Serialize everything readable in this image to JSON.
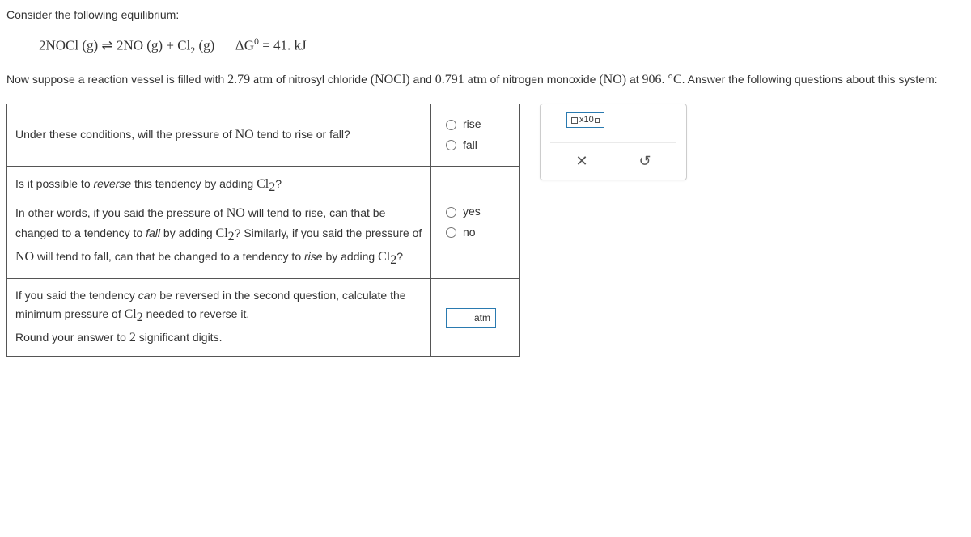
{
  "intro": "Consider the following equilibrium:",
  "equation": {
    "lhs": "2NOCl (g)",
    "arrow": "⇌",
    "rhs1": "2NO (g)",
    "plus": "+",
    "rhs2_cl": "Cl",
    "rhs2_sub": "2",
    "rhs2_state": " (g)",
    "dg_label": "ΔG",
    "dg_sup": "0",
    "dg_eq": " = 41. kJ"
  },
  "paragraph": {
    "p1a": "Now suppose a reaction vessel is filled with ",
    "p1_v1": "2.79 atm",
    "p1b": " of nitrosyl chloride ",
    "p1_f1": "(NOCl)",
    "p1c": " and ",
    "p1_v2": "0.791 atm",
    "p1d": " of nitrogen monoxide ",
    "p1_f2": "(NO)",
    "p1e": " at ",
    "p1_v3": "906. °C",
    "p1f": ". Answer the following questions about this system:"
  },
  "q1": {
    "a": "Under these conditions, will the pressure of ",
    "no": "NO",
    "b": " tend to rise or fall?",
    "opt_rise": "rise",
    "opt_fall": "fall"
  },
  "q2": {
    "l1a": "Is it possible to ",
    "l1_rev": "reverse",
    "l1b": " this tendency by adding ",
    "cl2_cl": "Cl",
    "cl2_sub": "2",
    "qmark": "?",
    "l2a": "In other words, if you said the pressure of ",
    "no": "NO",
    "l2b": " will tend to rise, can that be changed to a tendency to ",
    "fall_i": "fall",
    "l2c": " by adding ",
    "l2d": "? Similarly, if you said the pressure of ",
    "l2e": " will tend to fall, can that be changed to a tendency to ",
    "rise_i": "rise",
    "l2f": " by adding ",
    "opt_yes": "yes",
    "opt_no": "no"
  },
  "q3": {
    "l1a": "If you said the tendency ",
    "can_i": "can",
    "l1b": " be reversed in the second question, calculate the minimum pressure of ",
    "cl2_cl": "Cl",
    "cl2_sub": "2",
    "l1c": " needed to reverse it.",
    "l2a": "Round your answer to ",
    "two": "2",
    "l2b": " significant digits.",
    "unit": "atm"
  },
  "tool": {
    "x10": "x10",
    "close": "✕",
    "reset": "↺"
  }
}
